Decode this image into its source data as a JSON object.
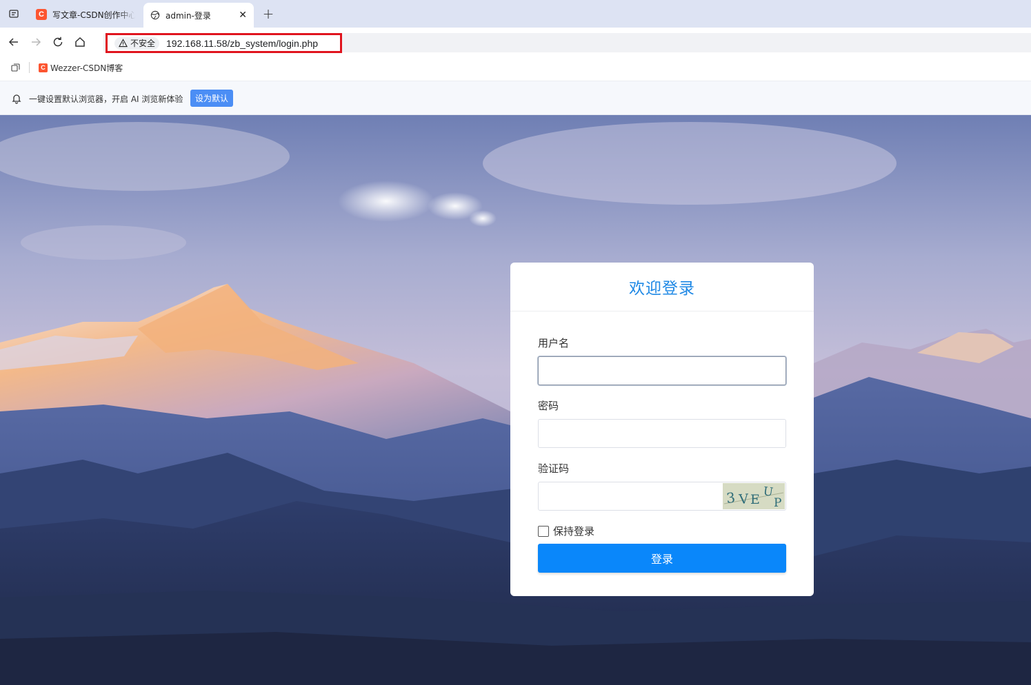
{
  "browser": {
    "tabs": [
      {
        "title": "写文章-CSDN创作中心",
        "favicon": "csdn-c-icon",
        "active": false
      },
      {
        "title": "admin-登录",
        "favicon": "globe-icon",
        "active": true
      }
    ],
    "favicon_letter": "C",
    "close_glyph": "✕",
    "new_tab_glyph": "+",
    "security_label": "不安全",
    "url": "192.168.11.58/zb_system/login.php",
    "bookmarks": [
      {
        "label": "Wezzer-CSDN博客",
        "favicon": "csdn-c-icon"
      }
    ],
    "infobar": {
      "message": "一键设置默认浏览器，开启 AI 浏览新体验",
      "button_label": "设为默认"
    },
    "colors": {
      "highlight_box": "#e0141e",
      "csdn_brand": "#fc5531",
      "infobar_button": "#4b8ef5"
    }
  },
  "login": {
    "title": "欢迎登录",
    "username_label": "用户名",
    "username_value": "",
    "password_label": "密码",
    "password_value": "",
    "captcha_label": "验证码",
    "captcha_value": "",
    "captcha_image_text": "3VEUP",
    "remember_label": "保持登录",
    "remember_checked": false,
    "submit_label": "登录",
    "colors": {
      "title": "#1e88e5",
      "submit_button": "#0a87fa"
    }
  }
}
